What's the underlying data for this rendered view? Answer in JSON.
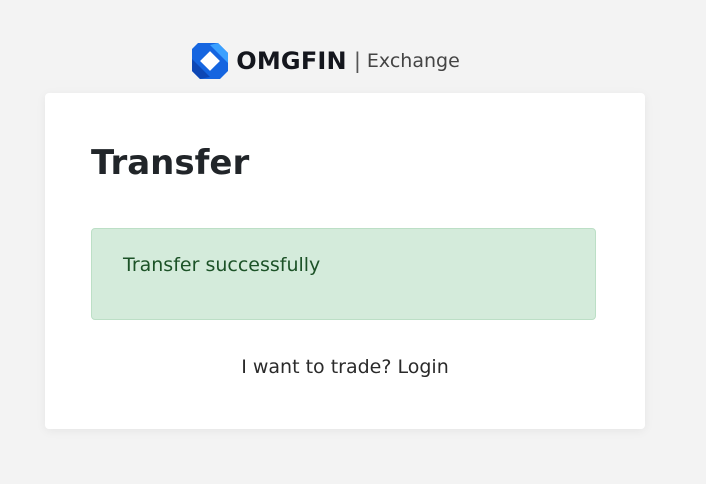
{
  "header": {
    "brand": "OMGFIN",
    "separator": "|",
    "subtitle": "Exchange",
    "logo_icon": "omgfin-diamond-logo-icon"
  },
  "card": {
    "title": "Transfer",
    "alert": {
      "message": "Transfer successfully",
      "type": "success"
    },
    "footer": {
      "prompt": "I want to trade?",
      "link_label": "Login"
    }
  },
  "colors": {
    "brand_blue": "#1a73e8",
    "alert_bg": "#d4ebdb",
    "alert_border": "#bcdfc6",
    "alert_text": "#1c5227",
    "page_bg": "#f3f3f3"
  }
}
